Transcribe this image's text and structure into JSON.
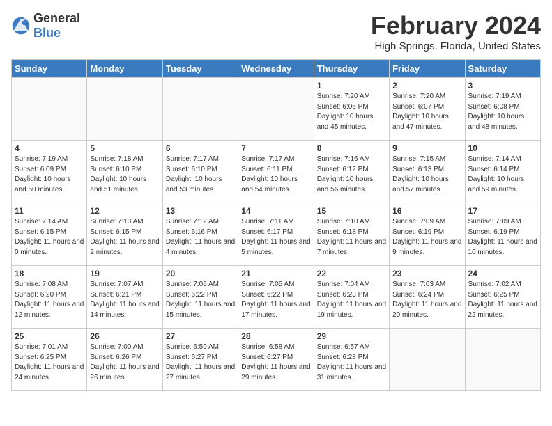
{
  "header": {
    "logo_general": "General",
    "logo_blue": "Blue",
    "month_year": "February 2024",
    "location": "High Springs, Florida, United States"
  },
  "weekdays": [
    "Sunday",
    "Monday",
    "Tuesday",
    "Wednesday",
    "Thursday",
    "Friday",
    "Saturday"
  ],
  "weeks": [
    [
      {
        "day": "",
        "empty": true
      },
      {
        "day": "",
        "empty": true
      },
      {
        "day": "",
        "empty": true
      },
      {
        "day": "",
        "empty": true
      },
      {
        "day": "1",
        "sunrise": "7:20 AM",
        "sunset": "6:06 PM",
        "daylight": "10 hours and 45 minutes."
      },
      {
        "day": "2",
        "sunrise": "7:20 AM",
        "sunset": "6:07 PM",
        "daylight": "10 hours and 47 minutes."
      },
      {
        "day": "3",
        "sunrise": "7:19 AM",
        "sunset": "6:08 PM",
        "daylight": "10 hours and 48 minutes."
      }
    ],
    [
      {
        "day": "4",
        "sunrise": "7:19 AM",
        "sunset": "6:09 PM",
        "daylight": "10 hours and 50 minutes."
      },
      {
        "day": "5",
        "sunrise": "7:18 AM",
        "sunset": "6:10 PM",
        "daylight": "10 hours and 51 minutes."
      },
      {
        "day": "6",
        "sunrise": "7:17 AM",
        "sunset": "6:10 PM",
        "daylight": "10 hours and 53 minutes."
      },
      {
        "day": "7",
        "sunrise": "7:17 AM",
        "sunset": "6:11 PM",
        "daylight": "10 hours and 54 minutes."
      },
      {
        "day": "8",
        "sunrise": "7:16 AM",
        "sunset": "6:12 PM",
        "daylight": "10 hours and 56 minutes."
      },
      {
        "day": "9",
        "sunrise": "7:15 AM",
        "sunset": "6:13 PM",
        "daylight": "10 hours and 57 minutes."
      },
      {
        "day": "10",
        "sunrise": "7:14 AM",
        "sunset": "6:14 PM",
        "daylight": "10 hours and 59 minutes."
      }
    ],
    [
      {
        "day": "11",
        "sunrise": "7:14 AM",
        "sunset": "6:15 PM",
        "daylight": "11 hours and 0 minutes."
      },
      {
        "day": "12",
        "sunrise": "7:13 AM",
        "sunset": "6:15 PM",
        "daylight": "11 hours and 2 minutes."
      },
      {
        "day": "13",
        "sunrise": "7:12 AM",
        "sunset": "6:16 PM",
        "daylight": "11 hours and 4 minutes."
      },
      {
        "day": "14",
        "sunrise": "7:11 AM",
        "sunset": "6:17 PM",
        "daylight": "11 hours and 5 minutes."
      },
      {
        "day": "15",
        "sunrise": "7:10 AM",
        "sunset": "6:18 PM",
        "daylight": "11 hours and 7 minutes."
      },
      {
        "day": "16",
        "sunrise": "7:09 AM",
        "sunset": "6:19 PM",
        "daylight": "11 hours and 9 minutes."
      },
      {
        "day": "17",
        "sunrise": "7:09 AM",
        "sunset": "6:19 PM",
        "daylight": "11 hours and 10 minutes."
      }
    ],
    [
      {
        "day": "18",
        "sunrise": "7:08 AM",
        "sunset": "6:20 PM",
        "daylight": "11 hours and 12 minutes."
      },
      {
        "day": "19",
        "sunrise": "7:07 AM",
        "sunset": "6:21 PM",
        "daylight": "11 hours and 14 minutes."
      },
      {
        "day": "20",
        "sunrise": "7:06 AM",
        "sunset": "6:22 PM",
        "daylight": "11 hours and 15 minutes."
      },
      {
        "day": "21",
        "sunrise": "7:05 AM",
        "sunset": "6:22 PM",
        "daylight": "11 hours and 17 minutes."
      },
      {
        "day": "22",
        "sunrise": "7:04 AM",
        "sunset": "6:23 PM",
        "daylight": "11 hours and 19 minutes."
      },
      {
        "day": "23",
        "sunrise": "7:03 AM",
        "sunset": "6:24 PM",
        "daylight": "11 hours and 20 minutes."
      },
      {
        "day": "24",
        "sunrise": "7:02 AM",
        "sunset": "6:25 PM",
        "daylight": "11 hours and 22 minutes."
      }
    ],
    [
      {
        "day": "25",
        "sunrise": "7:01 AM",
        "sunset": "6:25 PM",
        "daylight": "11 hours and 24 minutes."
      },
      {
        "day": "26",
        "sunrise": "7:00 AM",
        "sunset": "6:26 PM",
        "daylight": "11 hours and 26 minutes."
      },
      {
        "day": "27",
        "sunrise": "6:59 AM",
        "sunset": "6:27 PM",
        "daylight": "11 hours and 27 minutes."
      },
      {
        "day": "28",
        "sunrise": "6:58 AM",
        "sunset": "6:27 PM",
        "daylight": "11 hours and 29 minutes."
      },
      {
        "day": "29",
        "sunrise": "6:57 AM",
        "sunset": "6:28 PM",
        "daylight": "11 hours and 31 minutes."
      },
      {
        "day": "",
        "empty": true
      },
      {
        "day": "",
        "empty": true
      }
    ]
  ]
}
